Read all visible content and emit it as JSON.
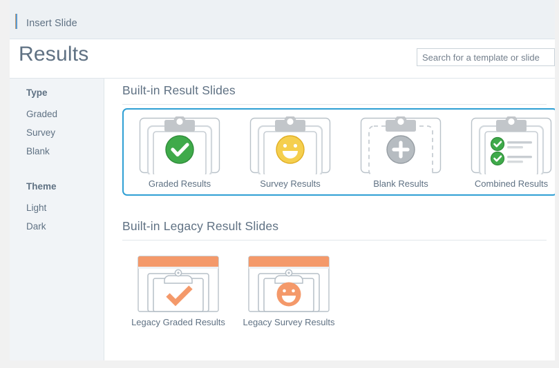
{
  "window": {
    "tab_label": "Insert Slide"
  },
  "header": {
    "title": "Results",
    "search_placeholder": "Search for a template or slide",
    "search_value": ""
  },
  "sidebar": {
    "groups": [
      {
        "title": "Type",
        "items": [
          {
            "label": "Graded"
          },
          {
            "label": "Survey"
          },
          {
            "label": "Blank"
          }
        ]
      },
      {
        "title": "Theme",
        "items": [
          {
            "label": "Light"
          },
          {
            "label": "Dark"
          }
        ]
      }
    ]
  },
  "sections": [
    {
      "title": "Built-in Result Slides",
      "selected": true,
      "tiles": [
        {
          "caption": "Graded Results",
          "icon": "clipboard-check-green"
        },
        {
          "caption": "Survey Results",
          "icon": "clipboard-smiley-yellow"
        },
        {
          "caption": "Blank Results",
          "icon": "clipboard-plus-gray"
        },
        {
          "caption": "Combined Results",
          "icon": "clipboard-checklist-green"
        }
      ]
    },
    {
      "title": "Built-in Legacy Result Slides",
      "selected": false,
      "tiles": [
        {
          "caption": "Legacy Graded Results",
          "icon": "legacy-checkmark-orange"
        },
        {
          "caption": "Legacy Survey Results",
          "icon": "legacy-smiley-orange"
        }
      ]
    }
  ],
  "colors": {
    "accent_selection": "#2e9fd4",
    "text": "#5f7183",
    "green": "#3faa4a",
    "yellow": "#f3c73f",
    "gray": "#9aa4ab",
    "orange": "#f28b52",
    "sidebar_bg": "#f1f4f7",
    "chrome_bg": "#edf1f4"
  }
}
